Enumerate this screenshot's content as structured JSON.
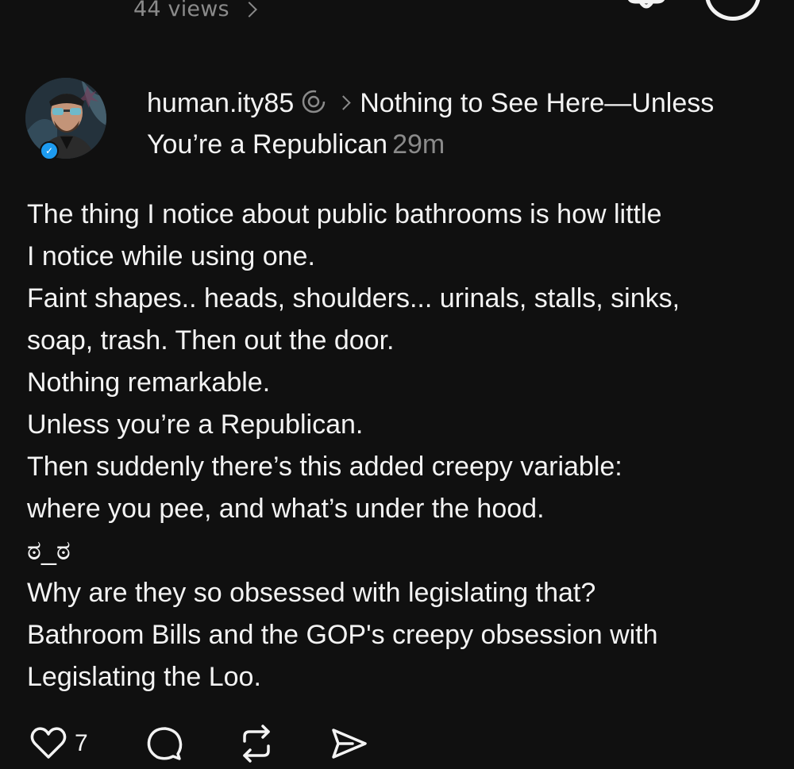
{
  "topbar": {
    "views_label": "44 views",
    "back_icon": "chevron-left-icon",
    "notification_icon": "bell-icon",
    "more_icon": "circle-icon"
  },
  "post": {
    "author": "human.ity85",
    "thread_title": "Nothing to See Here—Unless You’re a Republican",
    "time": "29m",
    "avatar_verified": true,
    "lines": [
      "The thing I notice about public bathrooms is how little",
      "I notice while using one.",
      "Faint shapes.. heads, shoulders... urinals, stalls, sinks,",
      "soap, trash. Then out the door.",
      "Nothing remarkable.",
      "Unless you’re a Republican.",
      "Then suddenly there’s this added creepy variable:",
      "where you pee, and what’s under the hood.",
      "ಠ_ಠ",
      "Why are they so obsessed with legislating that?",
      "Bathroom Bills and the GOP's creepy obsession with",
      "Legislating the Loo."
    ]
  },
  "actions": {
    "like_count": "7",
    "like_icon": "heart-icon",
    "comment_icon": "comment-icon",
    "repost_icon": "repost-icon",
    "share_icon": "send-icon"
  },
  "colors": {
    "background": "#101010",
    "text": "#f3f3f3",
    "muted": "#8a8a8a",
    "verified": "#1d9bf0"
  }
}
